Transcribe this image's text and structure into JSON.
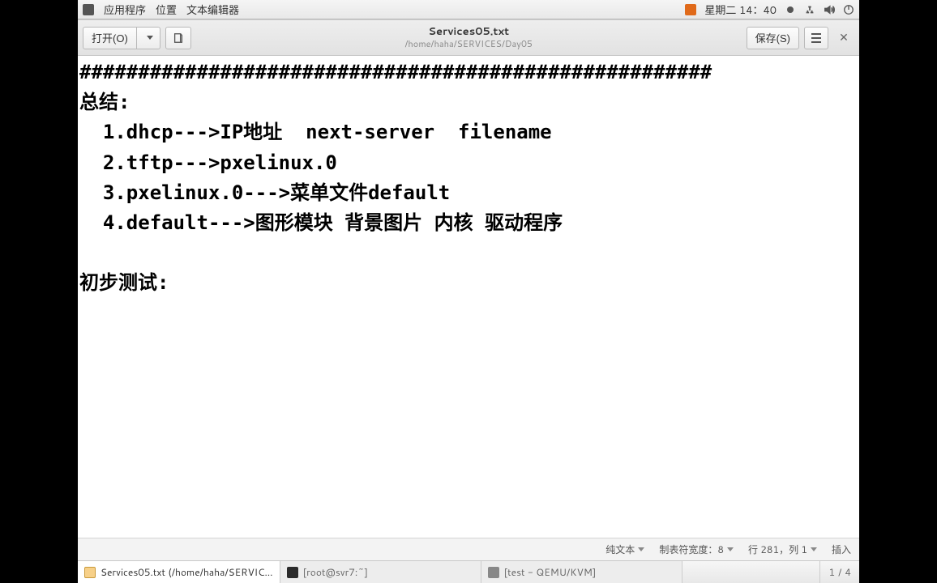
{
  "top_panel": {
    "apps": "应用程序",
    "places": "位置",
    "app_name": "文本编辑器",
    "clock": "星期二 14：40"
  },
  "titlebar": {
    "open_label": "打开(O)",
    "save_label": "保存(S)",
    "file_title": "Services05.txt",
    "file_path": "/home/haha/SERVICES/Day05"
  },
  "document": {
    "content": "######################################################\n总结:\n  1.dhcp--->IP地址  next-server  filename\n  2.tftp--->pxelinux.0\n  3.pxelinux.0--->菜单文件default\n  4.default--->图形模块 背景图片 内核 驱动程序\n\n初步测试:\n"
  },
  "status_bar": {
    "syntax": "纯文本",
    "tab_width": "制表符宽度：8",
    "cursor": "行 281，列 1",
    "mode": "插入"
  },
  "taskbar": {
    "items": [
      {
        "label": "Services05.txt (/home/haha/SERVIC…"
      },
      {
        "label": "[root@svr7:~]"
      },
      {
        "label": "[test - QEMU/KVM]"
      }
    ],
    "pager_current": "1",
    "pager_sep": "/",
    "pager_total": "4"
  }
}
